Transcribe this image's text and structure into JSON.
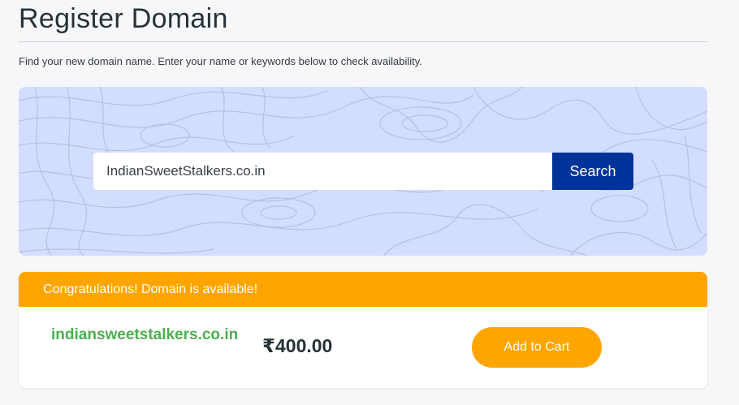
{
  "page": {
    "title": "Register Domain",
    "subtitle": "Find your new domain name. Enter your name or keywords below to check availability."
  },
  "search": {
    "value": "IndianSweetStalkers.co.in",
    "button_label": "Search"
  },
  "result": {
    "banner": "Congratulations! Domain is available!",
    "domain": "indiansweetstalkers.co.in",
    "price": "₹400.00",
    "add_to_cart_label": "Add to Cart"
  },
  "colors": {
    "accent_orange": "#ffa500",
    "search_button": "#003399",
    "domain_green": "#4caf50",
    "panel_background": "#d3ddff"
  }
}
